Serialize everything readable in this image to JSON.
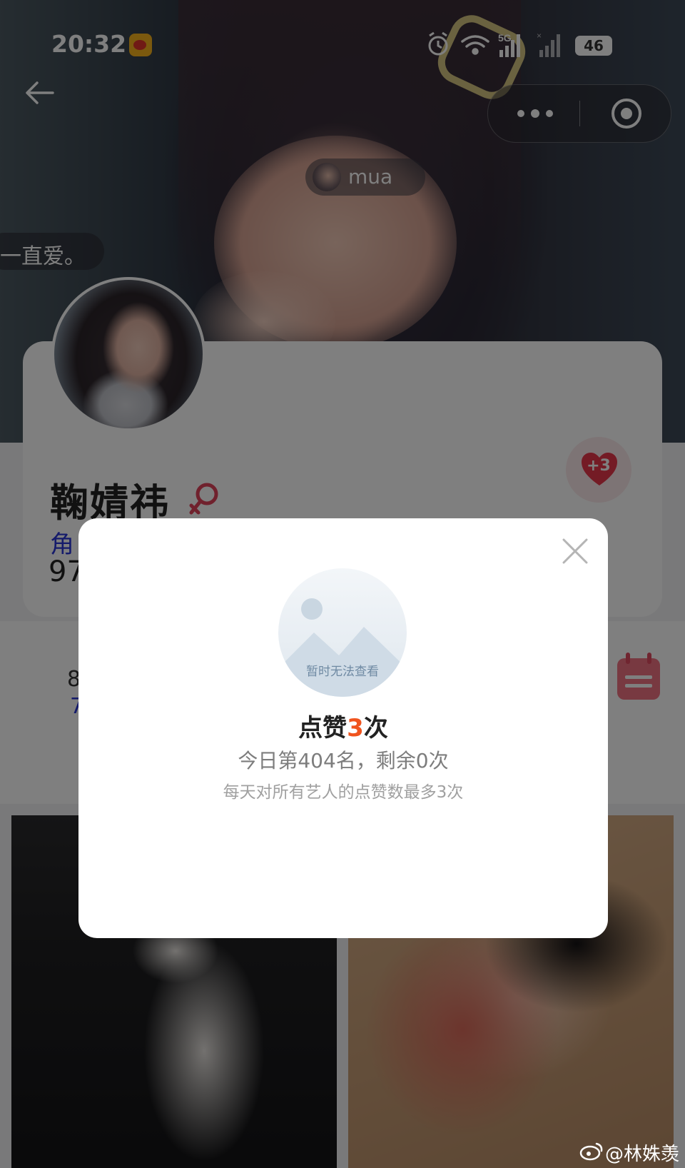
{
  "status_bar": {
    "time": "20:32",
    "network": "5G",
    "battery": "46"
  },
  "hero": {
    "bubble_user": "mua",
    "danmu_text": "一直爱。"
  },
  "profile": {
    "name": "鞠婧祎",
    "role_fragment": "角",
    "number_fragment": "97",
    "like_badge": "+3"
  },
  "stats_row": {
    "num1": "8",
    "num2": "7"
  },
  "modal": {
    "image_placeholder": "暂时无法查看",
    "title_prefix": "点赞",
    "title_count": "3",
    "title_suffix": "次",
    "rank_line": "今日第404名，剩余0次",
    "rule_line": "每天对所有艺人的点赞数最多3次"
  },
  "watermark": "@林姝羡",
  "colors": {
    "accent_orange": "#f0541e",
    "like_red": "#e8364a",
    "link_blue": "#2a36d6"
  }
}
